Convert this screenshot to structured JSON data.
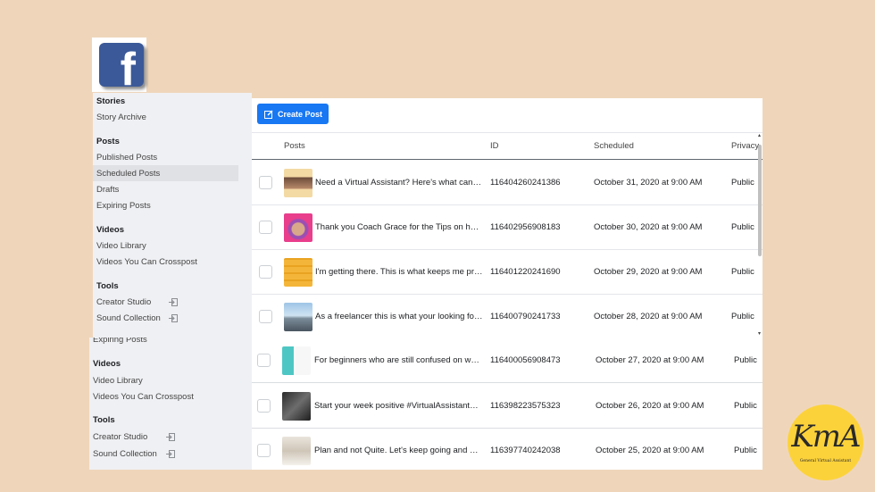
{
  "colors": {
    "accent": "#1877f2",
    "background": "#efd6bb",
    "sidebar": "#eff0f3",
    "facebook_logo": "#3b5998",
    "kma_badge": "#fcd23a"
  },
  "logo": {
    "icon": "facebook-f-logo"
  },
  "badge": {
    "monogram": "KmA",
    "subtitle": "General Virtual Assistant"
  },
  "sidebar_top": {
    "stories_header": "Stories",
    "story_archive": "Story Archive",
    "posts_header": "Posts",
    "published_posts": "Published Posts",
    "scheduled_posts": "Scheduled Posts",
    "drafts": "Drafts",
    "expiring_posts": "Expiring Posts",
    "videos_header": "Videos",
    "video_library": "Video Library",
    "videos_crosspost": "Videos You Can Crosspost",
    "tools_header": "Tools",
    "creator_studio": "Creator Studio",
    "sound_collection": "Sound Collection"
  },
  "sidebar_bottom": {
    "expiring_posts": "Expiring Posts",
    "videos_header": "Videos",
    "video_library": "Video Library",
    "videos_crosspost": "Videos You Can Crosspost",
    "tools_header": "Tools",
    "creator_studio": "Creator Studio",
    "sound_collection": "Sound Collection"
  },
  "toolbar": {
    "create_post": "Create Post"
  },
  "table": {
    "columns": {
      "posts": "Posts",
      "id": "ID",
      "scheduled": "Scheduled",
      "privacy": "Privacy"
    },
    "rows_top": [
      {
        "post": "Need a Virtual Assistant? Here's what can I of...",
        "id": "116404260241386",
        "scheduled": "October 31, 2020 at 9:00 AM",
        "privacy": "Public"
      },
      {
        "post": "Thank you Coach Grace for the Tips on how w...",
        "id": "116402956908183",
        "scheduled": "October 30, 2020 at 9:00 AM",
        "privacy": "Public"
      },
      {
        "post": "I'm getting there. This is what keeps me produ...",
        "id": "116401220241690",
        "scheduled": "October 29, 2020 at 9:00 AM",
        "privacy": "Public"
      },
      {
        "post": "As a freelancer this is what your looking forw...",
        "id": "116400790241733",
        "scheduled": "October 28, 2020 at 9:00 AM",
        "privacy": "Public"
      }
    ],
    "rows_bottom": [
      {
        "post": "For beginners who are still confused on what ...",
        "id": "116400056908473",
        "scheduled": "October 27, 2020 at 9:00 AM",
        "privacy": "Public"
      },
      {
        "post": "Start your week positive #VirtualAssistantSer...",
        "id": "116398223575323",
        "scheduled": "October 26, 2020 at 9:00 AM",
        "privacy": "Public"
      },
      {
        "post": "Plan and not Quite. Let's keep going and GOD ...",
        "id": "116397740242038",
        "scheduled": "October 25, 2020 at 9:00 AM",
        "privacy": "Public"
      }
    ]
  }
}
